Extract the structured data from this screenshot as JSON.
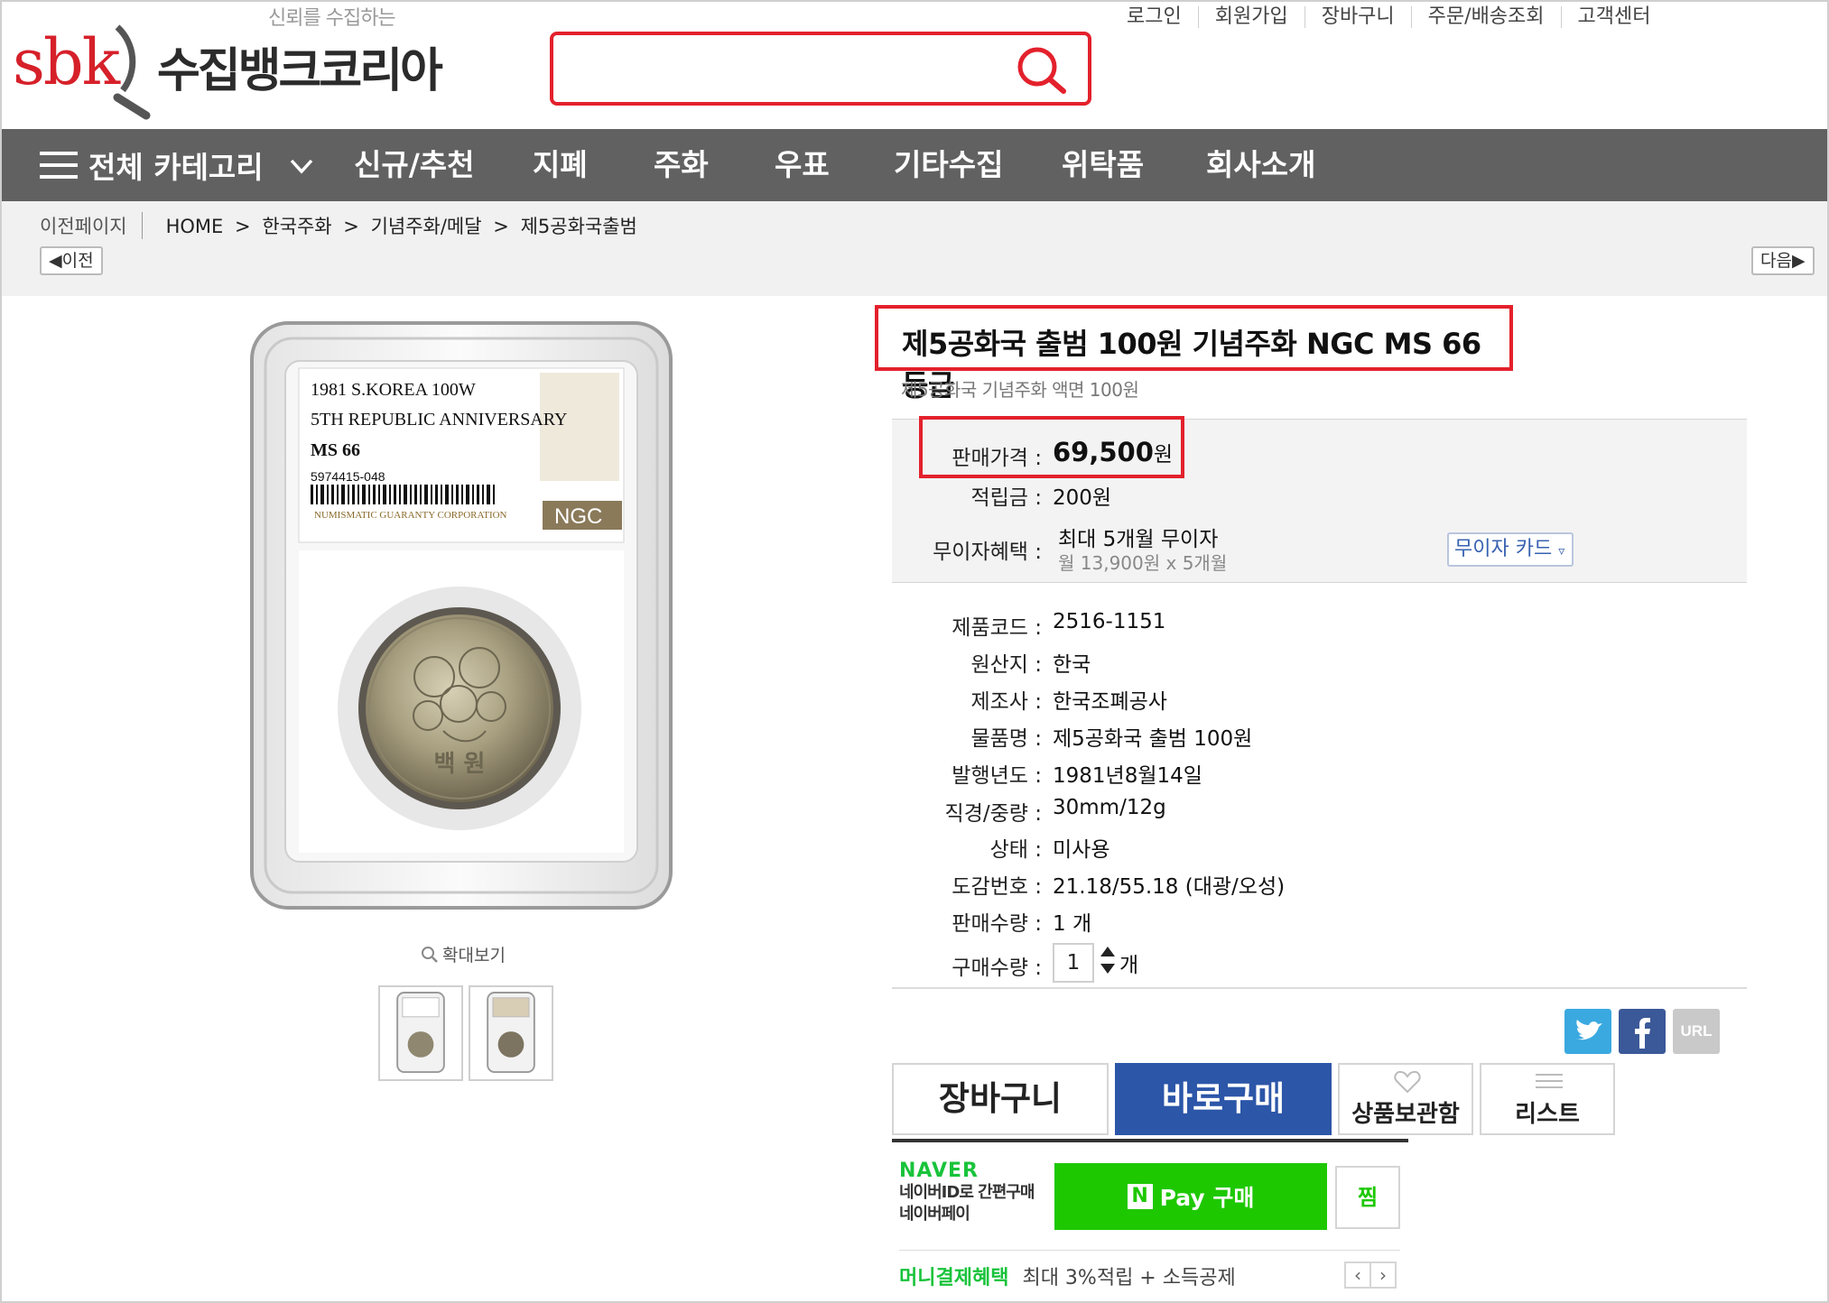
{
  "header": {
    "logo_tagline": "신뢰를 수집하는",
    "logo_sbk": "sbk",
    "logo_name": "수집뱅크코리아",
    "search_value": "",
    "top_menu": [
      "로그인",
      "회원가입",
      "장바구니",
      "주문/배송조회",
      "고객센터"
    ]
  },
  "nav": {
    "all_label": "전체 카테고리",
    "items": [
      "신규/추천",
      "지폐",
      "주화",
      "우표",
      "기타수집",
      "위탁품",
      "회사소개"
    ]
  },
  "breadcrumb": {
    "prev_page": "이전페이지",
    "path": [
      "HOME",
      ">",
      "한국주화",
      ">",
      "기념주화/메달",
      ">",
      "제5공화국출범"
    ],
    "prev_btn": "이전",
    "next_btn": "다음"
  },
  "slab": {
    "line1": "1981 S.KOREA 100W",
    "line2": "5TH REPUBLIC ANNIVERSARY",
    "grade": "MS 66",
    "cert": "5974415-048",
    "corp": "NUMISMATIC GUARANTY CORPORATION",
    "ngc": "NGC",
    "coin_text": "백 원"
  },
  "zoom_label": "확대보기",
  "product": {
    "title": "제5공화국 출범 100원 기념주화 NGC MS 66 등급",
    "subtitle": "제5공화국 기념주화 액면 100원",
    "price_label": "판매가격 :",
    "price": "69,500",
    "price_unit": "원",
    "points_label": "적립금 :",
    "points": "200원",
    "interest_label": "무이자혜택 :",
    "interest": "최대 5개월 무이자",
    "interest_sub": "월 13,900원 x 5개월",
    "card_btn": "무이자 카드",
    "specs": [
      {
        "label": "제품코드 :",
        "value": "2516-1151"
      },
      {
        "label": "원산지 :",
        "value": "한국"
      },
      {
        "label": "제조사 :",
        "value": "한국조폐공사"
      },
      {
        "label": "물품명 :",
        "value": "제5공화국 출범 100원"
      },
      {
        "label": "발행년도 :",
        "value": "1981년8월14일"
      },
      {
        "label": "직경/중량 :",
        "value": "30mm/12g"
      },
      {
        "label": "상태 :",
        "value": "미사용"
      },
      {
        "label": "도감번호 :",
        "value": "21.18/55.18 (대광/오성)"
      },
      {
        "label": "판매수량 :",
        "value": "1 개"
      }
    ],
    "qty_label": "구매수량 :",
    "qty_value": "1",
    "qty_unit": "개"
  },
  "share": {
    "url_label": "URL"
  },
  "buttons": {
    "cart": "장바구니",
    "buy_now": "바로구매",
    "wishlist": "상품보관함",
    "list": "리스트"
  },
  "naver": {
    "brand": "NAVER",
    "line1": "네이버ID로 간편구매",
    "line2": "네이버페이",
    "pay_n": "N",
    "pay_label": "Pay 구매",
    "zzim": "찜",
    "money_label": "머니결제혜택",
    "money_desc": "최대 3%적립 + 소득공제"
  },
  "colors": {
    "accent_red": "#e3212c",
    "nav_gray": "#616161",
    "buy_blue": "#2c56a8",
    "naver_green": "#1ec800"
  }
}
